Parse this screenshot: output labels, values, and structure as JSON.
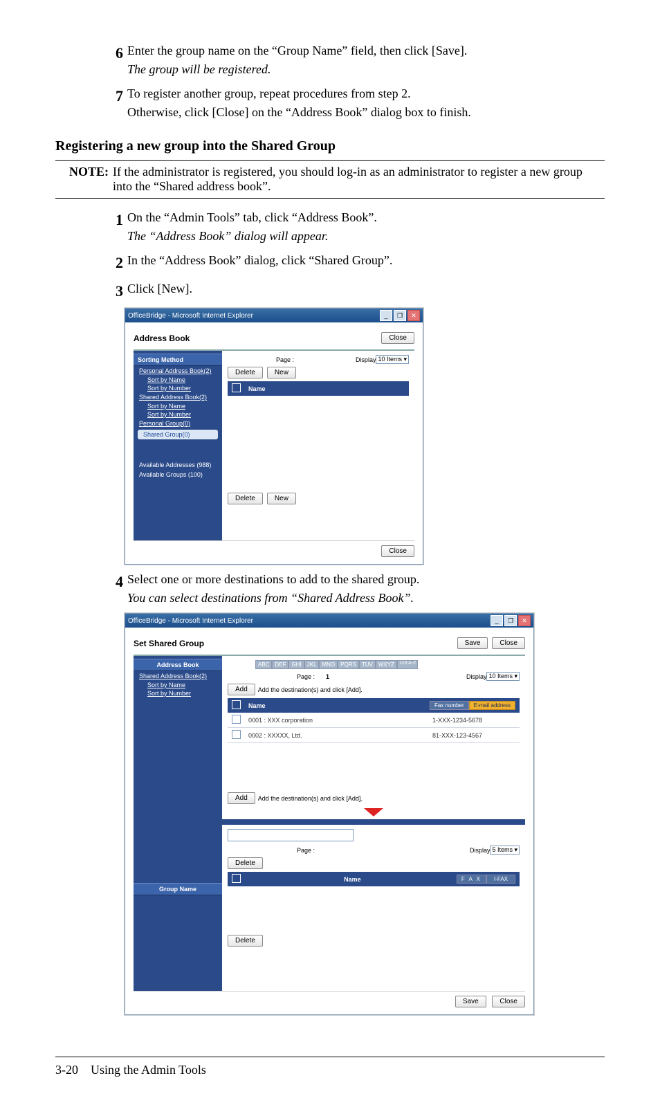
{
  "steps_a": {
    "s6": {
      "num": "6",
      "line1": "Enter the group name on the “Group Name” field, then click [Save].",
      "line2": "The group will be registered."
    },
    "s7": {
      "num": "7",
      "line1": "To register another group, repeat procedures from step 2.",
      "line2": "Otherwise, click [Close] on the “Address Book” dialog box to finish."
    }
  },
  "section_heading": "Registering a new group into the Shared Group",
  "note": {
    "label": "NOTE:",
    "text": "If the administrator is registered, you should log-in as an administrator to register a new group into the “Shared address book”."
  },
  "steps_b": {
    "s1": {
      "num": "1",
      "line1": "On the “Admin Tools” tab, click “Address Book”.",
      "line2": "The “Address Book” dialog will appear."
    },
    "s2": {
      "num": "2",
      "line1": "In the “Address Book” dialog, click “Shared Group”."
    },
    "s3": {
      "num": "3",
      "line1": "Click [New]."
    },
    "s4": {
      "num": "4",
      "line1": "Select one or more destinations to add to the shared group.",
      "line2": "You can select destinations from “Shared Address Book”."
    }
  },
  "screenshot1": {
    "window_title": "OfficeBridge - Microsoft Internet Explorer",
    "dialog_title": "Address Book",
    "close": "Close",
    "sidebar": {
      "sorting_method": "Sorting Method",
      "personal_ab": "Personal Address Book(2)",
      "sort_by_name": "Sort by Name",
      "sort_by_number": "Sort by Number",
      "shared_ab": "Shared Address Book(2)",
      "personal_group": "Personal Group(0)",
      "shared_group": "Shared Group(0)",
      "avail_addr": "Available Addresses (988)",
      "avail_groups": "Available Groups (100)"
    },
    "content": {
      "page_label": "Page :",
      "display_label": "Display",
      "display_value": "10 Items",
      "delete": "Delete",
      "new": "New",
      "name_hdr": "Name"
    }
  },
  "screenshot2": {
    "window_title": "OfficeBridge - Microsoft Internet Explorer",
    "dialog_title": "Set Shared Group",
    "save": "Save",
    "close": "Close",
    "sidebar": {
      "address_book": "Address Book",
      "shared_ab": "Shared Address Book(2)",
      "sort_by_name": "Sort by Name",
      "sort_by_number": "Sort by Number",
      "group_name": "Group Name"
    },
    "alpha": [
      "ABC",
      "DEF",
      "GHI",
      "JKL",
      "MNO",
      "PQRS",
      "TUV",
      "WXYZ",
      "123\nA-Z"
    ],
    "content": {
      "page_label": "Page :",
      "page_value": "1",
      "display_label": "Display",
      "display_value": "10 Items",
      "add": "Add",
      "add_hint": "Add the destination(s) and click [Add].",
      "name_hdr": "Name",
      "fax_tab": "Fax number",
      "email_tab": "E-mail address",
      "row1_name": "0001 : XXX corporation",
      "row1_num": "1-XXX-1234-5678",
      "row2_name": "0002 : XXXXX, Ltd.",
      "row2_num": "81-XXX-123-4567",
      "page_label2": "Page :",
      "display_label2": "Display",
      "display_value2": "5 Items",
      "delete": "Delete",
      "name_hdr2": "Name",
      "fax_hdr": "F A X",
      "ifax_hdr": "I-FAX"
    }
  },
  "footer": {
    "pagenum": "3-20",
    "title": "Using the Admin Tools"
  }
}
